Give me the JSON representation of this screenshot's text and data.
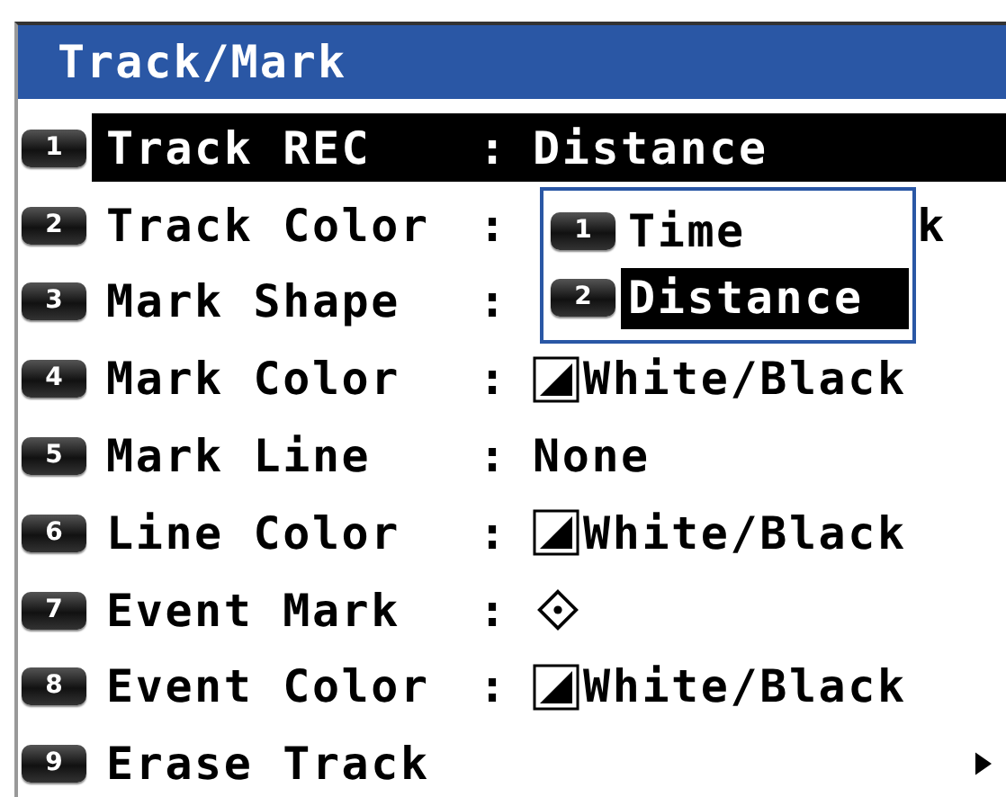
{
  "window": {
    "title": "Track/Mark"
  },
  "rows": [
    {
      "key": "1",
      "label": "Track REC",
      "colon": ":",
      "kind": "text",
      "value": "Distance",
      "selected": true
    },
    {
      "key": "2",
      "label": "Track Color",
      "colon": ":",
      "kind": "clipped",
      "value": "k",
      "selected": false
    },
    {
      "key": "3",
      "label": "Mark Shape",
      "colon": ":",
      "kind": "hidden",
      "selected": false
    },
    {
      "key": "4",
      "label": "Mark Color",
      "colon": ":",
      "kind": "swatch",
      "value": "White/Black",
      "selected": false
    },
    {
      "key": "5",
      "label": "Mark Line",
      "colon": ":",
      "kind": "text",
      "value": "None",
      "selected": false
    },
    {
      "key": "6",
      "label": "Line Color",
      "colon": ":",
      "kind": "swatch",
      "value": "White/Black",
      "selected": false
    },
    {
      "key": "7",
      "label": "Event Mark",
      "colon": ":",
      "kind": "diamond",
      "selected": false
    },
    {
      "key": "8",
      "label": "Event Color",
      "colon": ":",
      "kind": "swatch",
      "value": "White/Black",
      "selected": false
    },
    {
      "key": "9",
      "label": "Erase Track",
      "kind": "submenu",
      "selected": false
    }
  ],
  "popup": {
    "options": [
      {
        "key": "1",
        "label": "Time",
        "selected": false
      },
      {
        "key": "2",
        "label": "Distance",
        "selected": true
      }
    ]
  }
}
